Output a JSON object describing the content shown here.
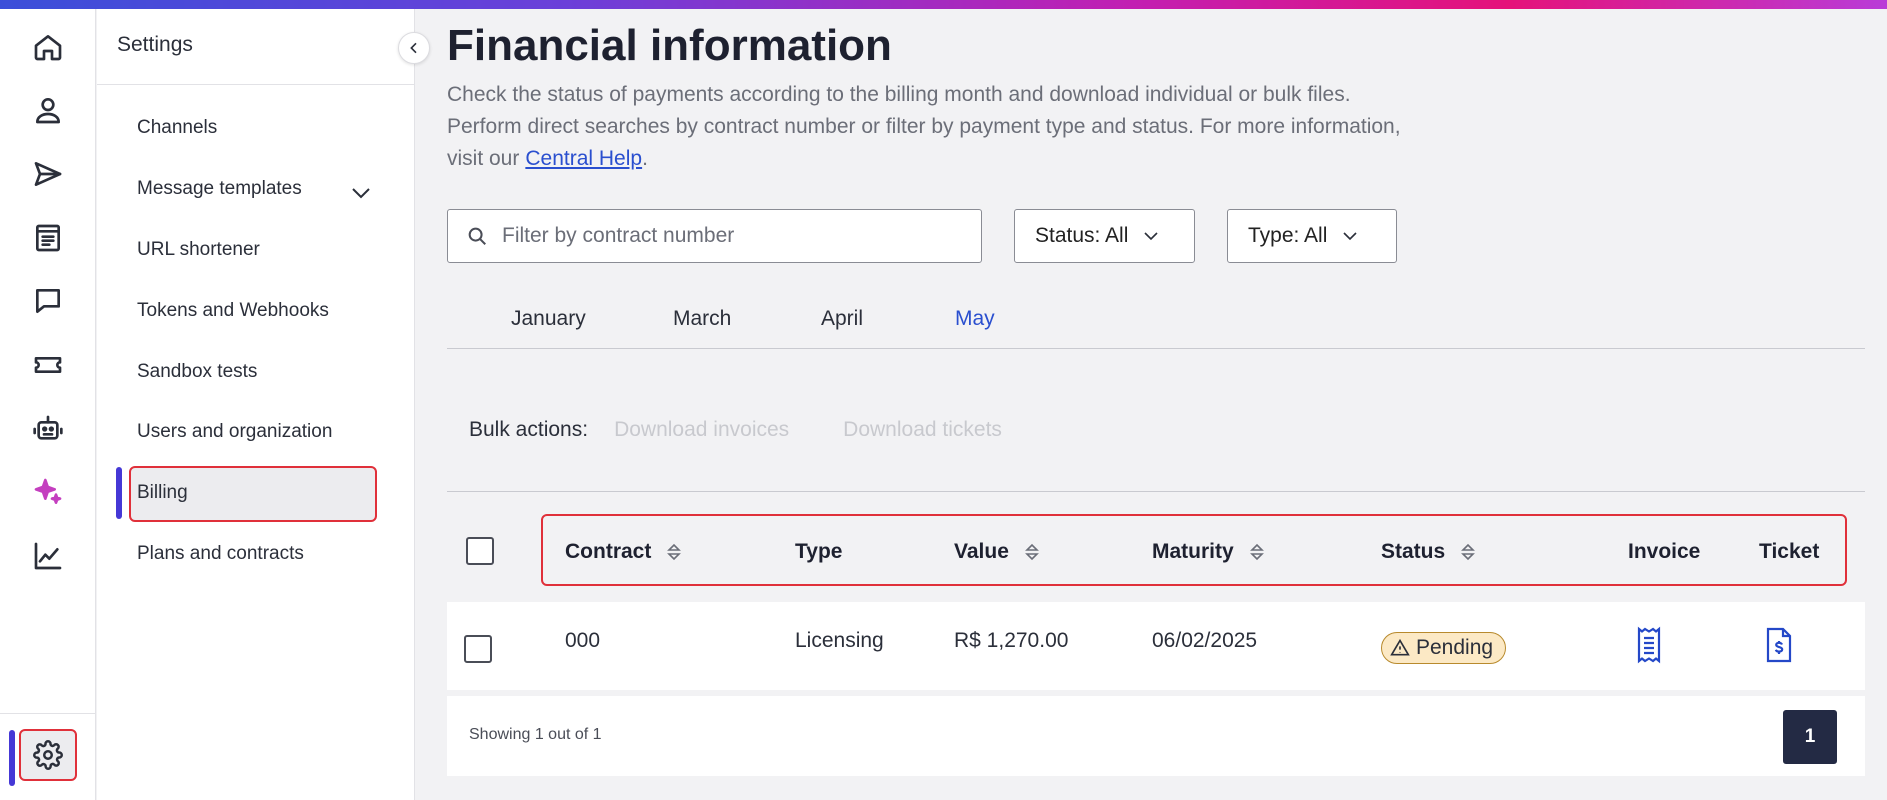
{
  "rail": {
    "icons": [
      "home-icon",
      "user-icon",
      "send-icon",
      "document-icon",
      "chat-icon",
      "ticket-icon",
      "bot-icon",
      "sparkles-icon",
      "chart-icon"
    ],
    "settings_icon": "gear-icon",
    "active_color": "#4538d6",
    "sparkles_color": "#c43fbf"
  },
  "sidebar": {
    "title": "Settings",
    "items": [
      {
        "label": "Channels"
      },
      {
        "label": "Message templates"
      },
      {
        "label": "URL shortener"
      },
      {
        "label": "Tokens and Webhooks"
      },
      {
        "label": "Sandbox tests"
      },
      {
        "label": "Users and organization"
      },
      {
        "label": "Billing"
      },
      {
        "label": "Plans and contracts"
      }
    ],
    "active": "Billing"
  },
  "main": {
    "title": "Financial information",
    "description_part1": "Check the status of payments according to the billing month and download individual or bulk files. Perform direct searches by contract number or filter by payment type and status. For more information, visit our",
    "help_link": "Central Help",
    "description_end": ".",
    "search": {
      "placeholder": "Filter by contract number",
      "value": ""
    },
    "status_filter": "Status: All",
    "type_filter": "Type: All",
    "tabs": [
      {
        "label": "January"
      },
      {
        "label": "March"
      },
      {
        "label": "April"
      },
      {
        "label": "May"
      }
    ],
    "active_tab": "May",
    "bulk": {
      "label": "Bulk actions:",
      "download_invoices": "Download invoices",
      "download_tickets": "Download tickets"
    },
    "table": {
      "columns": [
        "Contract",
        "Type",
        "Value",
        "Maturity",
        "Status",
        "Invoice",
        "Ticket"
      ],
      "rows": [
        {
          "contract": "000",
          "type": "Licensing",
          "value": "R$ 1,270.00",
          "maturity": "06/02/2025",
          "status": "Pending",
          "invoice_icon": "receipt-icon",
          "ticket_icon": "dollar-document-icon"
        }
      ]
    },
    "footer": {
      "showing": "Showing 1 out of 1",
      "page": "1"
    }
  },
  "colors": {
    "link": "#2a4fcf",
    "active_tab": "#2a4fcf",
    "highlight_border": "#e0303a",
    "pending_badge_bg": "#fce9c5",
    "pagination_bg": "#232a44"
  }
}
